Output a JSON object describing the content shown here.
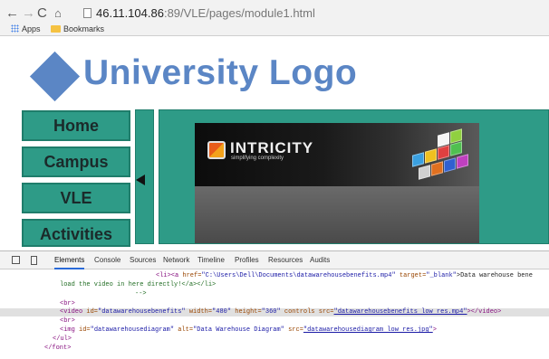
{
  "browser": {
    "url_host": "46.11.104.86",
    "url_rest": ":89/VLE/pages/module1.html",
    "bookmarks": [
      "Apps",
      "Bookmarks"
    ]
  },
  "site": {
    "logo_text": "University Logo",
    "nav": [
      "Home",
      "Campus",
      "VLE",
      "Activities"
    ]
  },
  "video": {
    "brand": "INTRICITY",
    "tagline": "simplifying complexity"
  },
  "devtools": {
    "tabs": [
      "Elements",
      "Console",
      "Sources",
      "Network",
      "Timeline",
      "Profiles",
      "Resources",
      "Audits"
    ],
    "line1_pre": "<li><a ",
    "line1_attr": "href=",
    "line1_val": "\"C:\\Users\\Dell\\Documents\\datawarehousebenefits.mp4\"",
    "line1_attr2": " target=",
    "line1_val2": "\"_blank\"",
    "line1_text": ">Data warehouse bene",
    "line2": "load the video in here directly!</a></li>",
    "line3": "-->",
    "line4": "<br>",
    "line5_tag": "<video ",
    "line5_a1": "id=",
    "line5_v1": "\"datawarehousebenefits\"",
    "line5_a2": " width=",
    "line5_v2": "\"480\"",
    "line5_a3": " height=",
    "line5_v3": "\"360\"",
    "line5_a4": " controls src=",
    "line5_v4": "\"datawarehousebenefits low res.mp4\"",
    "line5_end": "></video>",
    "line6": "<br>",
    "line7_tag": "<img ",
    "line7_a1": "id=",
    "line7_v1": "\"datawarehousediagram\"",
    "line7_a2": " alt=",
    "line7_v2": "\"Data Warehouse Diagram\"",
    "line7_a3": " src=",
    "line7_v3": "\"datawarehousediagram low res.jpg\"",
    "line7_end": ">",
    "line8": "</ul>",
    "line9": "</font>"
  }
}
